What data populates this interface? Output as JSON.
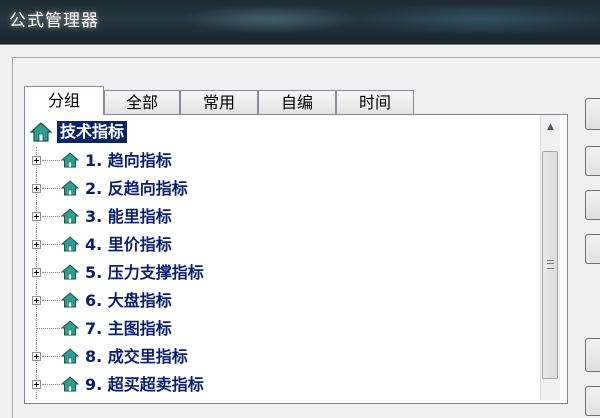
{
  "window": {
    "title": "公式管理器"
  },
  "tabs": [
    {
      "label": "分组",
      "active": true
    },
    {
      "label": "全部",
      "active": false
    },
    {
      "label": "常用",
      "active": false
    },
    {
      "label": "自编",
      "active": false
    },
    {
      "label": "时间",
      "active": false
    }
  ],
  "tree": {
    "root": {
      "label": "技术指标",
      "selected": true,
      "icon": "home-icon"
    },
    "items": [
      {
        "label": "1. 趋向指标",
        "expandable": true
      },
      {
        "label": "2. 反趋向指标",
        "expandable": true
      },
      {
        "label": "3. 能里指标",
        "expandable": true
      },
      {
        "label": "4. 里价指标",
        "expandable": true
      },
      {
        "label": "5. 压力支撑指标",
        "expandable": true
      },
      {
        "label": "6. 大盘指标",
        "expandable": true
      },
      {
        "label": "7. 主图指标",
        "expandable": false
      },
      {
        "label": "8. 成交里指标",
        "expandable": true
      },
      {
        "label": "9. 超买超卖指标",
        "expandable": true
      }
    ]
  },
  "colors": {
    "selection": "#0a246a",
    "item_text": "#0a1e6e",
    "house_icon": "#2f9e8f"
  }
}
